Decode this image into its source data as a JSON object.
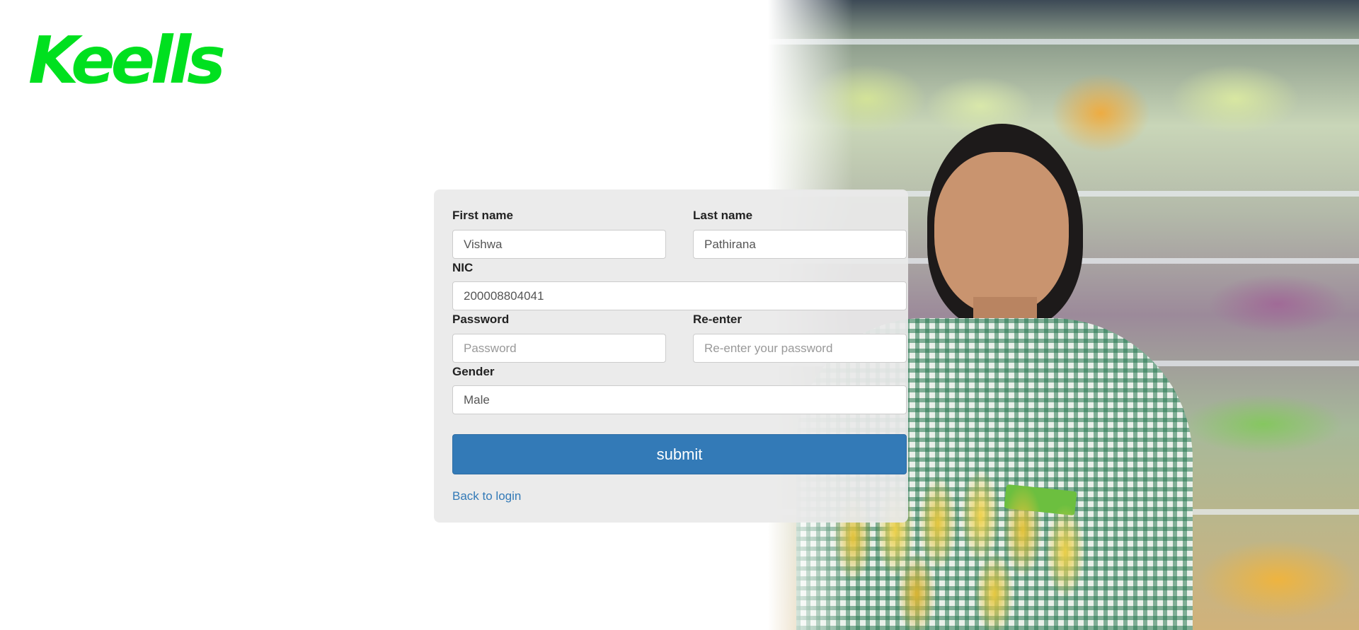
{
  "brand": {
    "logo_text": "Keells",
    "logo_color": "#00e01f"
  },
  "form": {
    "first_name": {
      "label": "First name",
      "value": "Vishwa"
    },
    "last_name": {
      "label": "Last name",
      "value": "Pathirana"
    },
    "nic": {
      "label": "NIC",
      "value": "200008804041"
    },
    "password": {
      "label": "Password",
      "placeholder": "Password"
    },
    "reenter": {
      "label": "Re-enter",
      "placeholder": "Re-enter your password"
    },
    "gender": {
      "label": "Gender",
      "value": "Male"
    },
    "submit_label": "submit",
    "back_link": "Back to login"
  },
  "colors": {
    "primary": "#337ab7",
    "card_bg": "#e9e9e9"
  }
}
